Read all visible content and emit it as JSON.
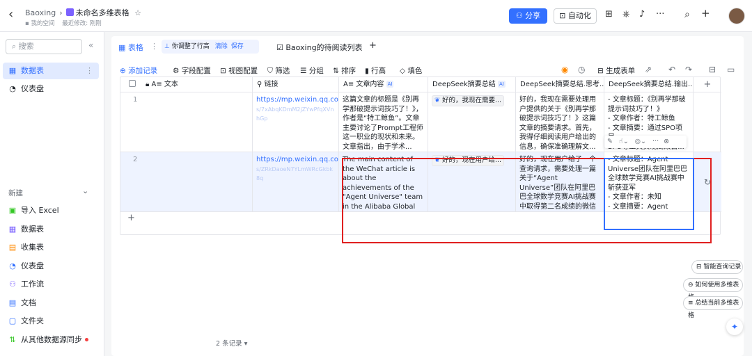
{
  "header": {
    "back_glyph": "‹",
    "space": "Baoxing",
    "sep": "›",
    "doc_title": "未命名多维表格",
    "star_glyph": "☆",
    "sub_space": "我的空间",
    "sub_modified": "最近修改: 刚刚",
    "share_label": "分享",
    "auto_label": "自动化",
    "more_glyph": "···",
    "search_glyph": "⌕",
    "plus_glyph": "+",
    "bell_glyph": "♫"
  },
  "sidebar": {
    "search_placeholder": "搜索",
    "collapse_glyph": "«",
    "top_items": [
      {
        "label": "数据表",
        "icon": "▦"
      },
      {
        "label": "仪表盘",
        "icon": "◔"
      }
    ],
    "new_label": "新建",
    "new_chevron": "⌄",
    "new_items": [
      {
        "label": "导入 Excel",
        "icon": "▣"
      },
      {
        "label": "数据表",
        "icon": "▦"
      },
      {
        "label": "收集表",
        "icon": "▤"
      },
      {
        "label": "仪表盘",
        "icon": "◔"
      },
      {
        "label": "工作流",
        "icon": "⚇"
      },
      {
        "label": "文档",
        "icon": "▤"
      },
      {
        "label": "文件夹",
        "icon": "▢"
      },
      {
        "label": "从其他数据源同步",
        "icon": "⇅"
      }
    ],
    "sync_dot_color": "#f53f3f"
  },
  "tabs": {
    "table_tab": "表格",
    "chip_text": "你调整了行高",
    "chip_clear": "清除",
    "chip_save": "保存",
    "reading_tab": "Baoxing的待阅读列表",
    "add_tab": "+"
  },
  "toolbar": {
    "add_record": "添加记录",
    "field_config": "字段配置",
    "view_config": "视图配置",
    "filter": "筛选",
    "group": "分组",
    "sort": "排序",
    "row_height": "行高",
    "fill": "填色",
    "generate_form": "生成表单"
  },
  "grid": {
    "columns": [
      "A≡ 文本",
      "链接",
      "A≡ 文章内容",
      "DeepSeek摘要总结",
      "DeepSeek摘要总结.思考...",
      "DeepSeek摘要总结.输出..."
    ],
    "ai_badge": "AI",
    "add_col": "+",
    "rows": [
      {
        "num": "1",
        "link": "https://mp.weixin.qq.com",
        "link_rest": "/s/7xAbqKDmM2jZYwPfqXVnhGp",
        "content": "这篇文章的标题是《别再学那破提示词技巧了！》，作者是“特工鲸鱼”。文章主要讨论了Prompt工程师这一职业的现状和未来。文章指出，由于学术...",
        "summary": "好的，我现在需要...",
        "thinking": "好的，我现在需要处理用户提供的关于《别再学那破提示词技巧了！》这篇文章的摘要请求。首先，我得仔细阅读用户给出的信息，确保准确理解文...",
        "output": "- 文章标题：《别再学那破提示词技巧了！》\n- 文章作者：特工鲸鱼\n- 文章摘要：通过SPO项目\nSPO等工具实现高效自..."
      },
      {
        "num": "2",
        "link": "https://mp.weixin.qq.com",
        "link_rest": "/s/ZRkDaoeN7YLmWRcGkbk8q",
        "content": "The main content of the WeChat article is about the achievements of the \"Agent Universe\" team in the Alibaba Global Mathematical Competiti...",
        "summary": "好的，现在用户给...",
        "thinking": "好的，现在用户给了一个查询请求，需要处理一篇关于“Agent Universe”团队在阿里巴巴全球数学竞赛AI挑战赛中取得第二名成绩的微信文章。用户是...",
        "output": "- 文章标题：Agent Universe团队在阿里巴巴全球数学竞赛AI挑战赛中斩获亚军\n- 文章作者：未知\n- 文章摘要：Agent Universe团队运用多智能体协作技术..."
      }
    ],
    "add_row": "+"
  },
  "record_count": "2 条记录",
  "pills": [
    "智能查询记录",
    "如何使用多维表格",
    "总结当前多维表格"
  ],
  "colors": {
    "accent": "#3370ff",
    "highlight": "#e02020"
  }
}
